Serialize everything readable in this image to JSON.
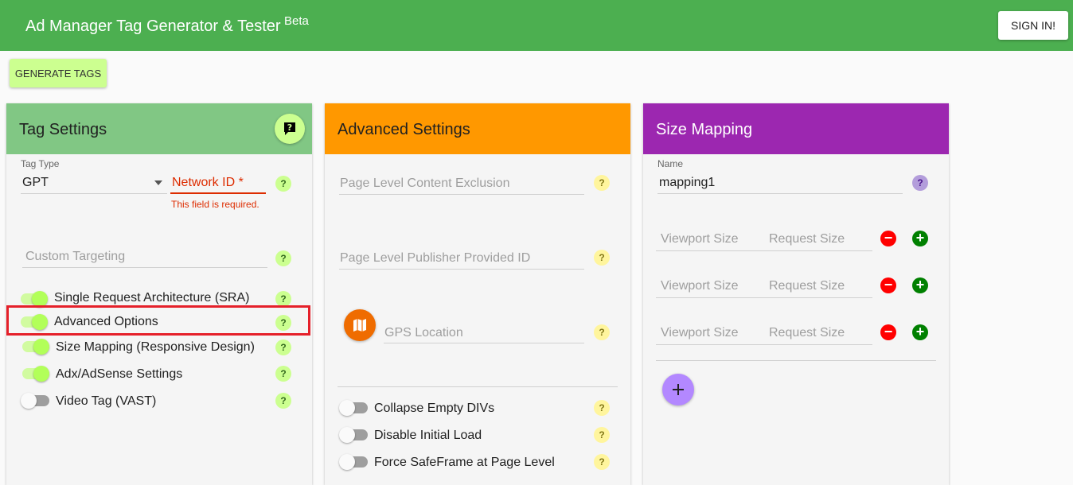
{
  "app": {
    "title": "Ad Manager Tag Generator & Tester",
    "badge": "Beta",
    "sign_in": "SIGN IN!"
  },
  "toolbar": {
    "generate": "GENERATE TAGS"
  },
  "tag_settings": {
    "title": "Tag Settings",
    "tag_type_label": "Tag Type",
    "tag_type_value": "GPT",
    "network_id_label": "Network ID *",
    "network_id_error": "This field is required.",
    "custom_targeting_placeholder": "Custom Targeting",
    "toggles": [
      {
        "label": "Single Request Architecture (SRA)",
        "on": true
      },
      {
        "label": "Advanced Options",
        "on": true
      },
      {
        "label": "Size Mapping (Responsive Design)",
        "on": true
      },
      {
        "label": "Adx/AdSense Settings",
        "on": true
      },
      {
        "label": "Video Tag (VAST)",
        "on": false
      }
    ],
    "help": "?"
  },
  "advanced_settings": {
    "title": "Advanced Settings",
    "page_level_content_exclusion": "Page Level Content Exclusion",
    "page_level_ppid": "Page Level Publisher Provided ID",
    "gps_location": "GPS Location",
    "toggles": [
      {
        "label": "Collapse Empty DIVs",
        "on": false
      },
      {
        "label": "Disable Initial Load",
        "on": false
      },
      {
        "label": "Force SafeFrame at Page Level",
        "on": false
      }
    ]
  },
  "size_mapping": {
    "title": "Size Mapping",
    "name_label": "Name",
    "name_value": "mapping1",
    "rows": [
      {
        "viewport": "Viewport Size",
        "request": "Request Size"
      },
      {
        "viewport": "Viewport Size",
        "request": "Request Size"
      },
      {
        "viewport": "Viewport Size",
        "request": "Request Size"
      }
    ]
  },
  "colors": {
    "green": "#4caf50",
    "tag_head": "#81c784",
    "orange": "#ff9800",
    "purple": "#9c27b0",
    "highlight": "#e5202a"
  }
}
